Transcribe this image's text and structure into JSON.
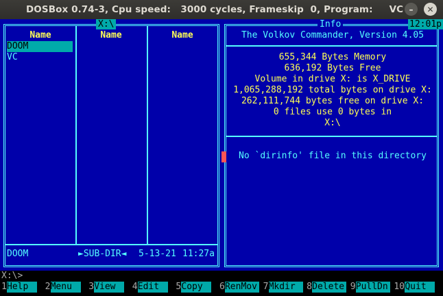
{
  "window": {
    "title": "DOSBox 0.74-3, Cpu speed:   3000 cycles, Frameskip  0, Program:     VC",
    "minimize_glyph": "–",
    "close_glyph": "✕"
  },
  "left_panel": {
    "path": "X:\\",
    "column_headers": [
      "Name",
      "Name",
      "Name"
    ],
    "files": [
      {
        "name": "DOOM",
        "selected": true
      },
      {
        "name": "VC",
        "selected": false
      }
    ],
    "status": {
      "name": "DOOM",
      "type": "►SUB-DIR◄",
      "date": "5-13-21",
      "time": "11:27a"
    }
  },
  "right_panel": {
    "title": "Info",
    "clock": "12:01p",
    "lines": [
      "The Volkov Commander, Version 4.05",
      "655,344 Bytes Memory",
      "636,192 Bytes Free",
      "Volume in drive X: is X_DRIVE",
      "1,065,288,192 total bytes on drive X:",
      "262,111,744 bytes free on drive X:",
      "0 files use 0 bytes in",
      "X:\\"
    ],
    "dirinfo": "No `dirinfo' file in this directory"
  },
  "prompt": "X:\\>",
  "function_keys": [
    {
      "num": "1",
      "label": "Help"
    },
    {
      "num": "2",
      "label": "Menu"
    },
    {
      "num": "3",
      "label": "View"
    },
    {
      "num": "4",
      "label": "Edit"
    },
    {
      "num": "5",
      "label": "Copy"
    },
    {
      "num": "6",
      "label": "RenMov"
    },
    {
      "num": "7",
      "label": "Mkdir"
    },
    {
      "num": "8",
      "label": "Delete"
    },
    {
      "num": "9",
      "label": "PullDn"
    },
    {
      "num": "10",
      "label": "Quit"
    }
  ],
  "colors": {
    "panel_bg": "#0000aa",
    "frame": "#55ffff",
    "highlight": "#00aaaa",
    "text_yellow": "#ffff55",
    "marker": "#ff5555"
  }
}
